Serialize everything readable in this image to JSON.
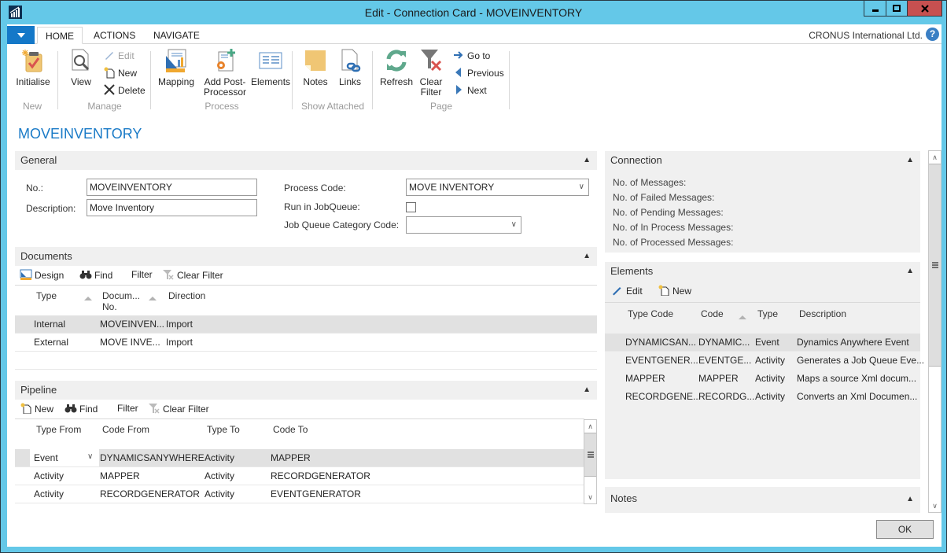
{
  "window": {
    "title": "Edit - Connection Card - MOVEINVENTORY",
    "minimize_glyph": "—",
    "maximize_glyph": "□",
    "close_glyph": "X"
  },
  "ribbon": {
    "tabs": [
      {
        "label": "HOME",
        "active": true
      },
      {
        "label": "ACTIONS",
        "active": false
      },
      {
        "label": "NAVIGATE",
        "active": false
      }
    ],
    "company": "CRONUS International Ltd.",
    "help_glyph": "?",
    "groups": {
      "new": {
        "label": "New",
        "initialise": "Initialise"
      },
      "manage": {
        "label": "Manage",
        "view": "View",
        "edit": "Edit",
        "new": "New",
        "delete": "Delete"
      },
      "process": {
        "label": "Process",
        "mapping": "Mapping",
        "add_post_1": "Add Post-",
        "add_post_2": "Processor",
        "elements": "Elements"
      },
      "show_attached": {
        "label": "Show Attached",
        "notes": "Notes",
        "links": "Links"
      },
      "page": {
        "label": "Page",
        "refresh": "Refresh",
        "clear_filter_1": "Clear",
        "clear_filter_2": "Filter",
        "go_to": "Go to",
        "previous": "Previous",
        "next": "Next"
      }
    }
  },
  "page_title": "MOVEINVENTORY",
  "general": {
    "title": "General",
    "no_label": "No.:",
    "no_value": "MOVEINVENTORY",
    "description_label": "Description:",
    "description_value": "Move Inventory",
    "process_code_label": "Process Code:",
    "process_code_value": "MOVE INVENTORY",
    "run_in_jobqueue_label": "Run in JobQueue:",
    "run_in_jobqueue_checked": false,
    "job_queue_category_label": "Job Queue Category Code:",
    "job_queue_category_value": ""
  },
  "documents": {
    "title": "Documents",
    "actions": {
      "design": "Design",
      "find": "Find",
      "filter": "Filter",
      "clear_filter": "Clear Filter"
    },
    "columns": {
      "type": "Type",
      "doc_no_1": "Docum...",
      "doc_no_2": "No.",
      "direction": "Direction"
    },
    "rows": [
      {
        "type": "Internal",
        "doc_no": "MOVEINVEN...",
        "direction": "Import"
      },
      {
        "type": "External",
        "doc_no": "MOVE INVE...",
        "direction": "Import"
      }
    ]
  },
  "pipeline": {
    "title": "Pipeline",
    "actions": {
      "new": "New",
      "find": "Find",
      "filter": "Filter",
      "clear_filter": "Clear Filter"
    },
    "columns": {
      "type_from": "Type From",
      "code_from": "Code From",
      "type_to": "Type To",
      "code_to": "Code To"
    },
    "rows": [
      {
        "type_from": "Event",
        "code_from": "DYNAMICSANYWHERE",
        "type_to": "Activity",
        "code_to": "MAPPER"
      },
      {
        "type_from": "Activity",
        "code_from": "MAPPER",
        "type_to": "Activity",
        "code_to": "RECORDGENERATOR"
      },
      {
        "type_from": "Activity",
        "code_from": "RECORDGENERATOR",
        "type_to": "Activity",
        "code_to": "EVENTGENERATOR"
      }
    ]
  },
  "connection": {
    "title": "Connection",
    "labels": [
      "No. of Messages:",
      "No. of Failed Messages:",
      "No. of Pending Messages:",
      "No. of In Process Messages:",
      "No. of Processed Messages:"
    ]
  },
  "elements": {
    "title": "Elements",
    "actions": {
      "edit": "Edit",
      "new": "New"
    },
    "columns": {
      "type_code": "Type Code",
      "code": "Code",
      "type": "Type",
      "description": "Description"
    },
    "rows": [
      {
        "type_code": "DYNAMICSAN...",
        "code": "DYNAMIC...",
        "type": "Event",
        "description": "Dynamics Anywhere Event"
      },
      {
        "type_code": "EVENTGENER...",
        "code": "EVENTGE...",
        "type": "Activity",
        "description": "Generates a Job Queue Eve..."
      },
      {
        "type_code": "MAPPER",
        "code": "MAPPER",
        "type": "Activity",
        "description": "Maps a source Xml docum..."
      },
      {
        "type_code": "RECORDGENE...",
        "code": "RECORDG...",
        "type": "Activity",
        "description": "Converts an Xml Documen..."
      }
    ]
  },
  "notes": {
    "title": "Notes"
  },
  "ok_button": "OK",
  "glyphs": {
    "collapse": "▲",
    "dropdown": "∨",
    "scroll_up": "∧",
    "scroll_down": "∨"
  },
  "colors": {
    "accent": "#1b7bc7",
    "window_frame": "#64c8e8",
    "close_button": "#c75050",
    "menu_button": "#1478c8"
  }
}
